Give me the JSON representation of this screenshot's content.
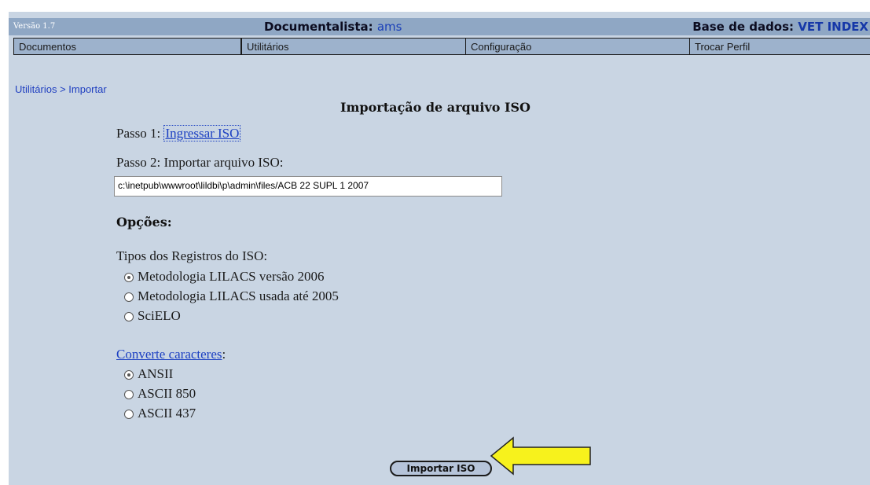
{
  "header": {
    "version": "Versão 1.7",
    "documentalist_label": "Documentalista:",
    "documentalist_user": "ams",
    "database_label": "Base de dados:",
    "database_name": "VET INDEX"
  },
  "menu": {
    "items": [
      {
        "label": "Documentos"
      },
      {
        "label": "Utilitários"
      },
      {
        "label": "Configuração"
      },
      {
        "label": "Trocar Perfil"
      }
    ]
  },
  "breadcrumb": "Utilitários > Importar",
  "title": "Importação de arquivo ISO",
  "step1": {
    "prefix": "Passo 1:",
    "link": "Ingressar ISO"
  },
  "step2": {
    "label": "Passo 2: Importar arquivo ISO:",
    "path_value": "c:\\inetpub\\wwwroot\\lildbi\\p\\admin\\files/ACB 22 SUPL 1 2007"
  },
  "options": {
    "heading": "Opções:",
    "types_label": "Tipos dos Registros do ISO:",
    "types": [
      {
        "label": "Metodologia LILACS versão 2006",
        "checked": true
      },
      {
        "label": "Metodologia LILACS usada até 2005",
        "checked": false
      },
      {
        "label": "SciELO",
        "checked": false
      }
    ],
    "convert_link": "Converte caracteres",
    "convert_suffix": ":",
    "conversions": [
      {
        "label": "ANSII",
        "checked": true
      },
      {
        "label": "ASCII 850",
        "checked": false
      },
      {
        "label": "ASCII 437",
        "checked": false
      }
    ]
  },
  "import_button": "Importar ISO",
  "colors": {
    "accent_arrow": "#f7f21c",
    "link": "#1b3fc2",
    "menu_bar": "#9db2cc",
    "background": "#c9d5e3"
  }
}
